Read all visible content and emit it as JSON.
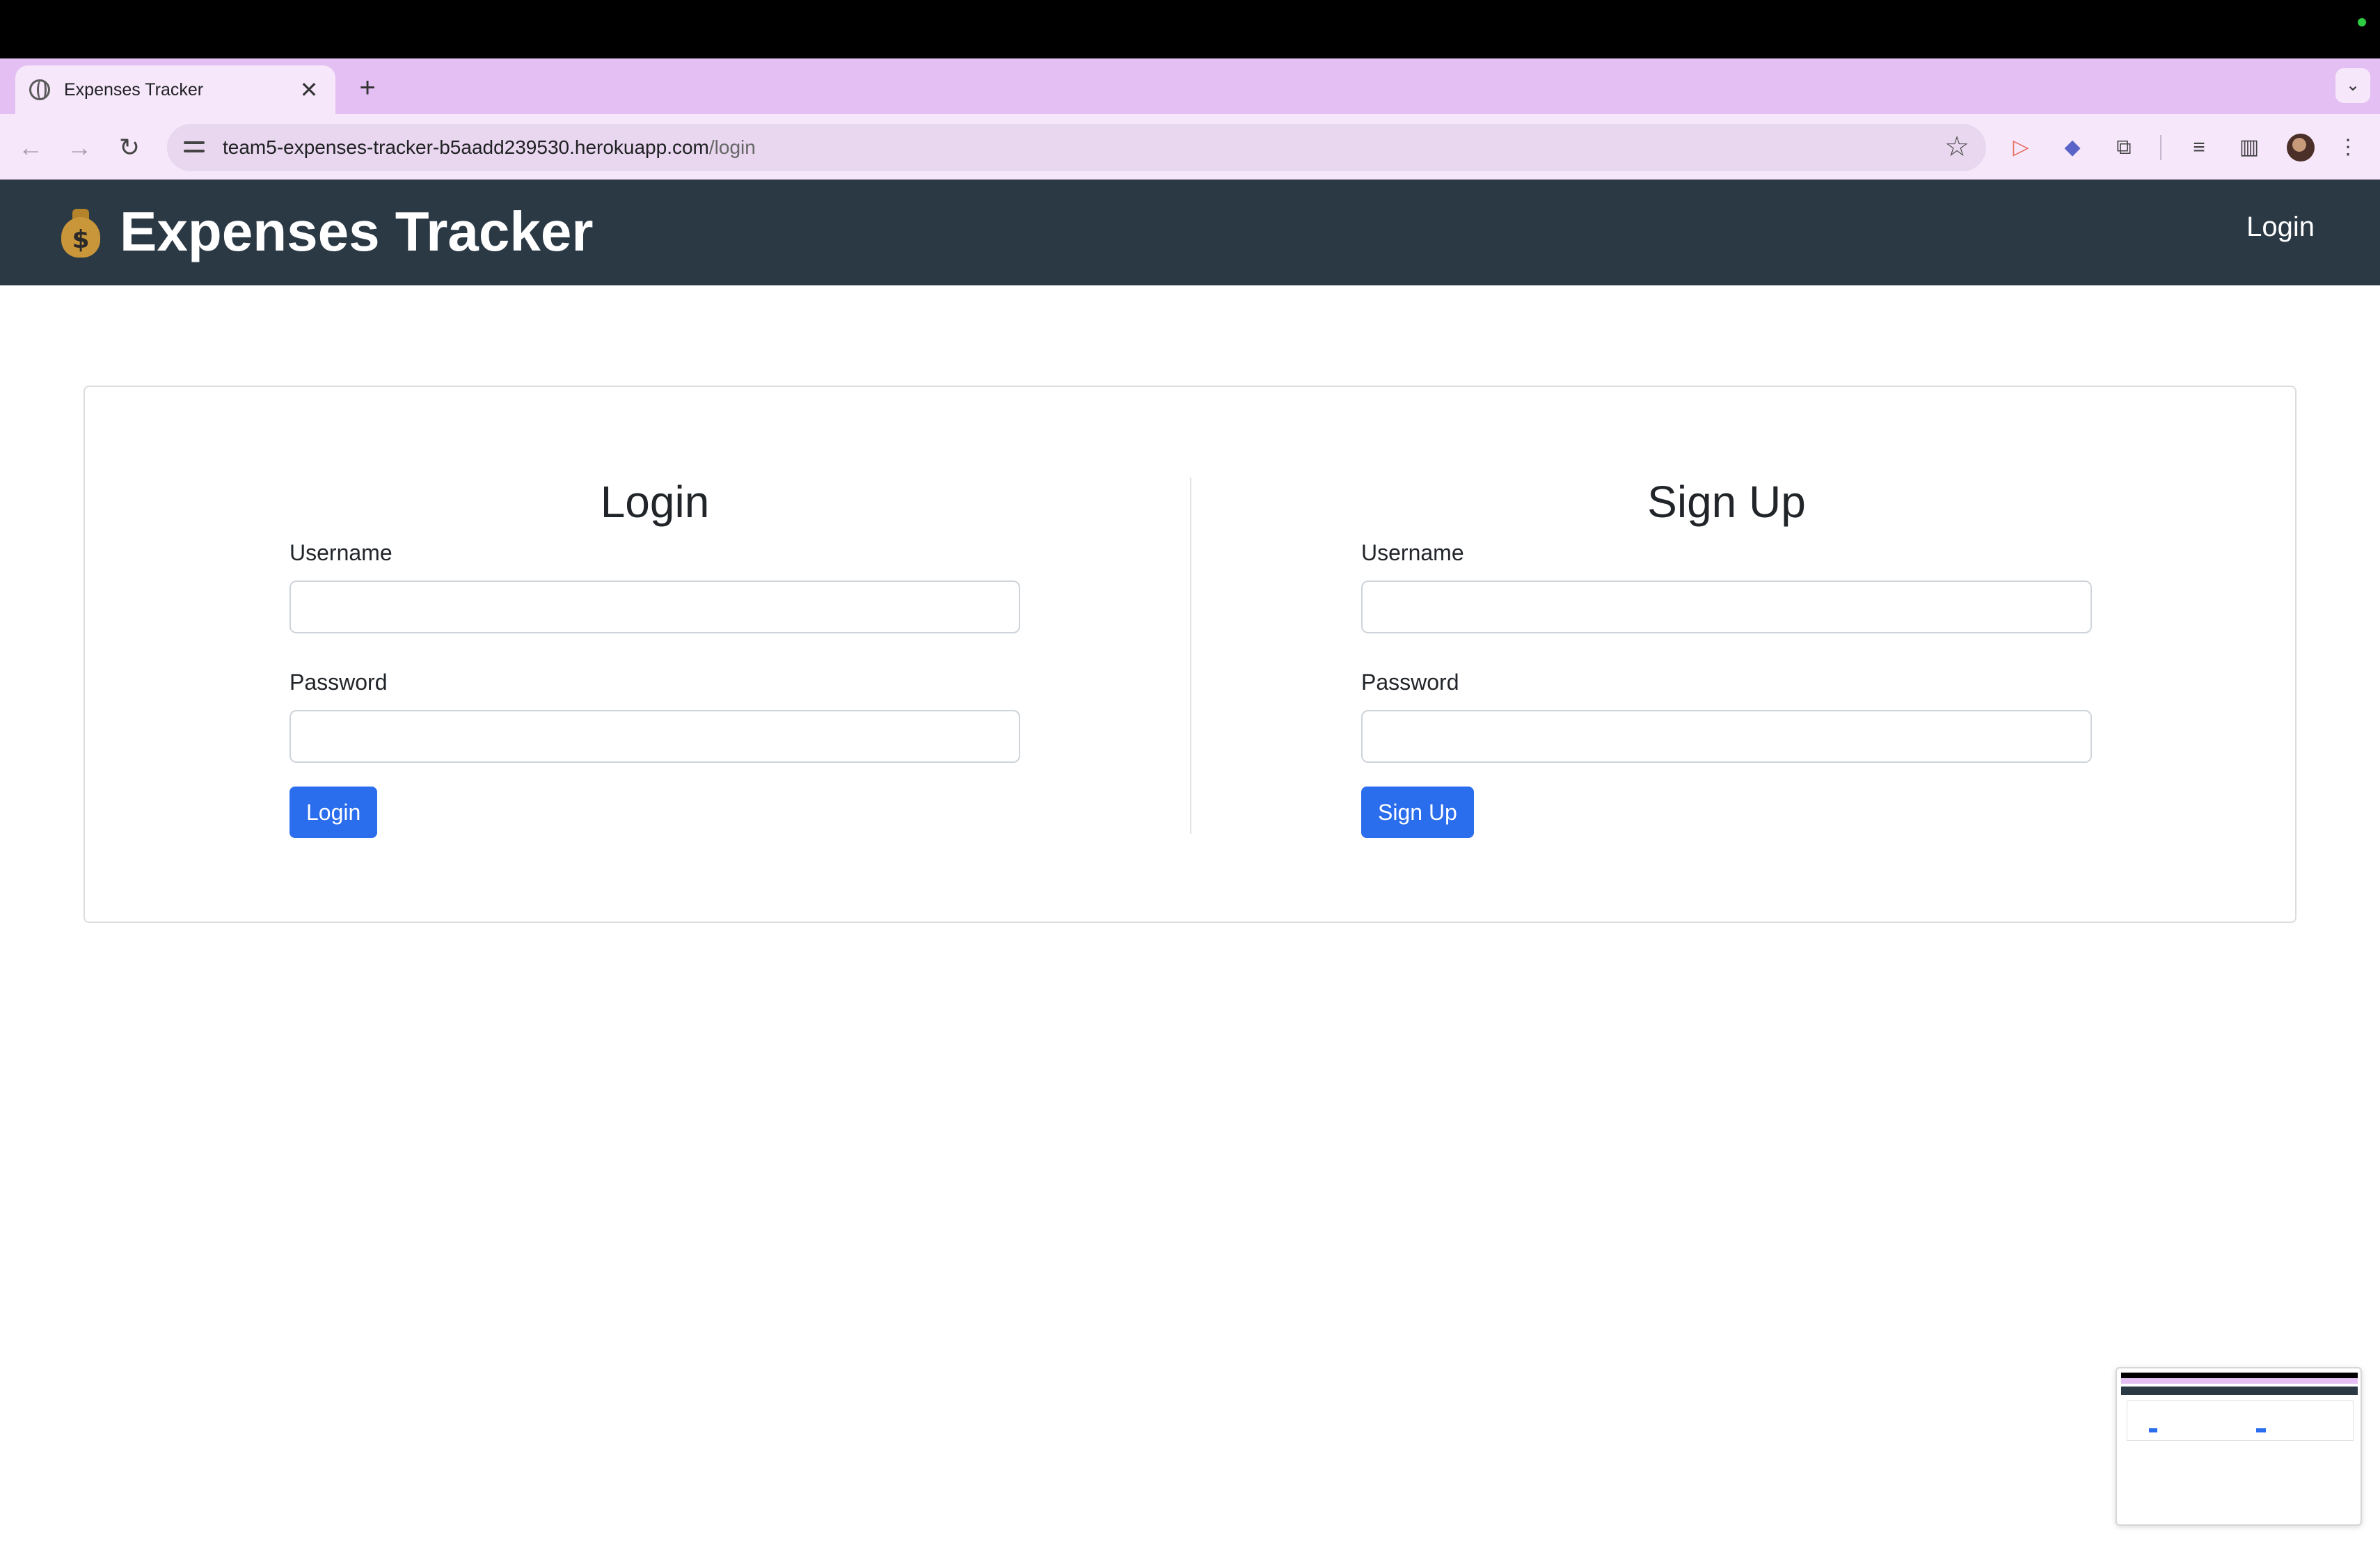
{
  "browser": {
    "tab_title": "Expenses Tracker",
    "tab_close_glyph": "✕",
    "new_tab_glyph": "+",
    "tab_menu_glyph": "⌄",
    "url_host": "team5-expenses-tracker-b5aadd239530.herokuapp.com",
    "url_path": "/login",
    "icons": [
      "back-icon",
      "forward-icon",
      "reload-icon",
      "site-info-icon",
      "bookmark-star-icon",
      "extension-icons",
      "extensions-puzzle-icon",
      "reading-list-icon",
      "side-panel-icon",
      "profile-avatar",
      "menu-kebab-icon"
    ]
  },
  "app": {
    "brand_title": "Expenses Tracker",
    "brand_icon": "money-bag-icon",
    "nav_login": "Login",
    "colors": {
      "navbar": "#2b3945",
      "primary_button": "#2a6ded"
    }
  },
  "login_form": {
    "title": "Login",
    "username_label": "Username",
    "username_value": "",
    "password_label": "Password",
    "password_value": "",
    "submit_label": "Login"
  },
  "signup_form": {
    "title": "Sign Up",
    "username_label": "Username",
    "username_value": "",
    "password_label": "Password",
    "password_value": "",
    "submit_label": "Sign Up"
  }
}
